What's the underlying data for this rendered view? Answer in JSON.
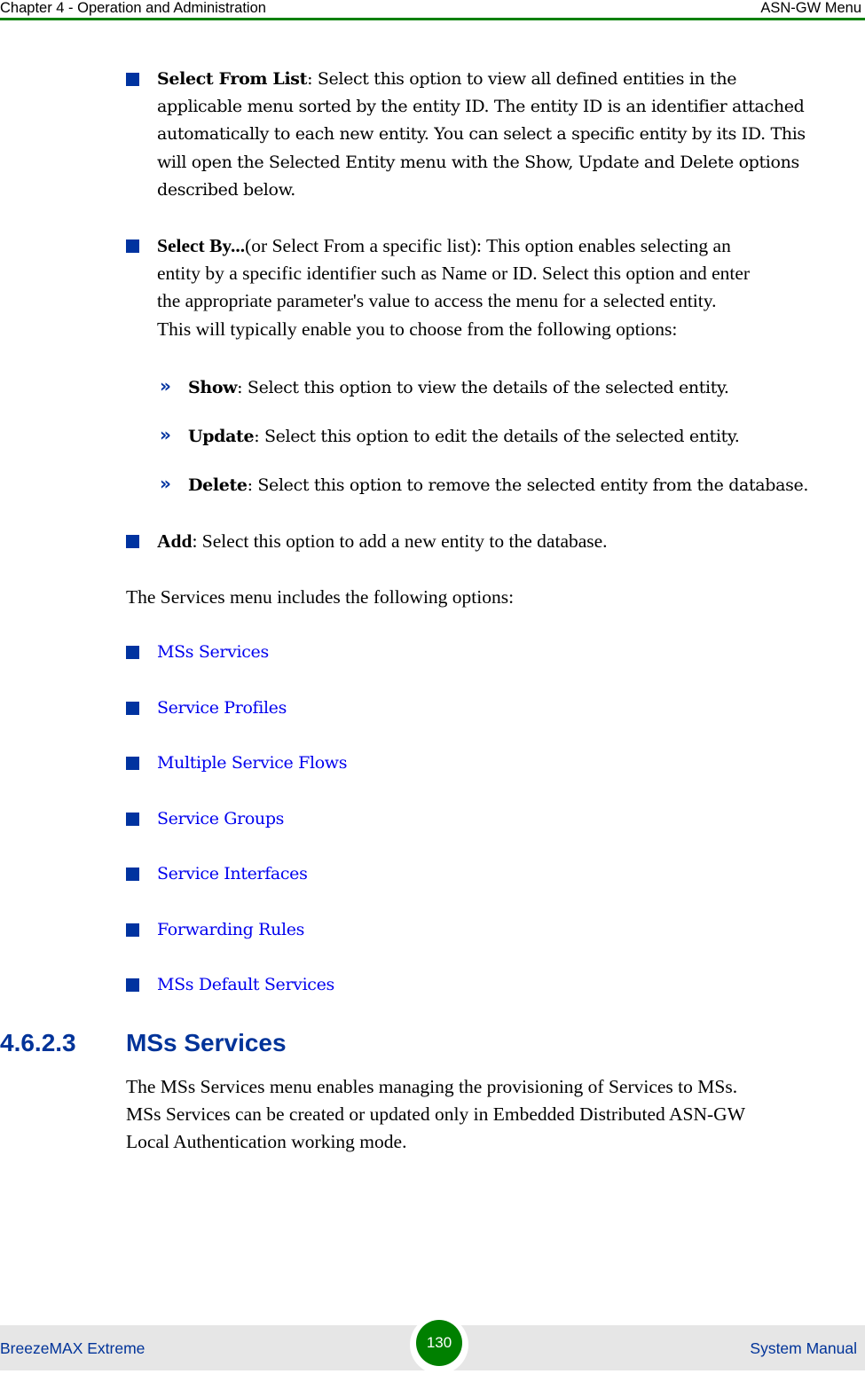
{
  "header": {
    "chapter": "Chapter 4 - Operation and Administration",
    "section": "ASN-GW Menu",
    "rule_color": "#008000"
  },
  "options": [
    {
      "term": "Select From List",
      "lines": [
        ": Select this option to view all defined entities in the",
        "applicable menu sorted by the entity ID. The entity ID is an identifier attached",
        "automatically to each new entity. You can select a specific entity by its ID. This",
        "will open the Selected Entity menu with the Show, Update and Delete options",
        "described below."
      ]
    },
    {
      "term": "Select By...",
      "lines": [
        "(or Select From a specific list): This option enables selecting an",
        "entity by a specific identifier such as Name or ID. Select this option and enter",
        "the appropriate parameter's value to access the menu for a selected entity.",
        "This will typically enable you to choose from the following options:"
      ]
    }
  ],
  "sub_options": [
    {
      "term": "Show",
      "text": ": Select this option to view the details of the selected entity."
    },
    {
      "term": "Update",
      "text": ": Select this option to edit the details of the selected entity."
    },
    {
      "term": "Delete",
      "text": ": Select this option to remove the selected entity from the database."
    }
  ],
  "add_option": {
    "term": "Add",
    "text": ": Select this option to add a new entity to the database."
  },
  "services_intro": "The Services menu includes the following options:",
  "services_links": [
    "MSs Services",
    "Service Profiles",
    "Multiple Service Flows",
    "Service Groups",
    "Service Interfaces",
    "Forwarding Rules",
    "MSs Default Services"
  ],
  "section": {
    "number": "4.6.2.3",
    "title": "MSs Services",
    "body_lines": [
      "The MSs Services menu enables managing the provisioning of Services to MSs.",
      "MSs Services can be created or updated only in Embedded Distributed ASN-GW",
      "Local Authentication working mode."
    ]
  },
  "footer": {
    "product": "BreezeMAX Extreme",
    "page_number": "130",
    "doc_type": "System Manual"
  },
  "colors": {
    "accent_green": "#008000",
    "heading_blue": "#003399",
    "bullet_blue": "#0033a0",
    "link_blue": "#0000ee"
  }
}
